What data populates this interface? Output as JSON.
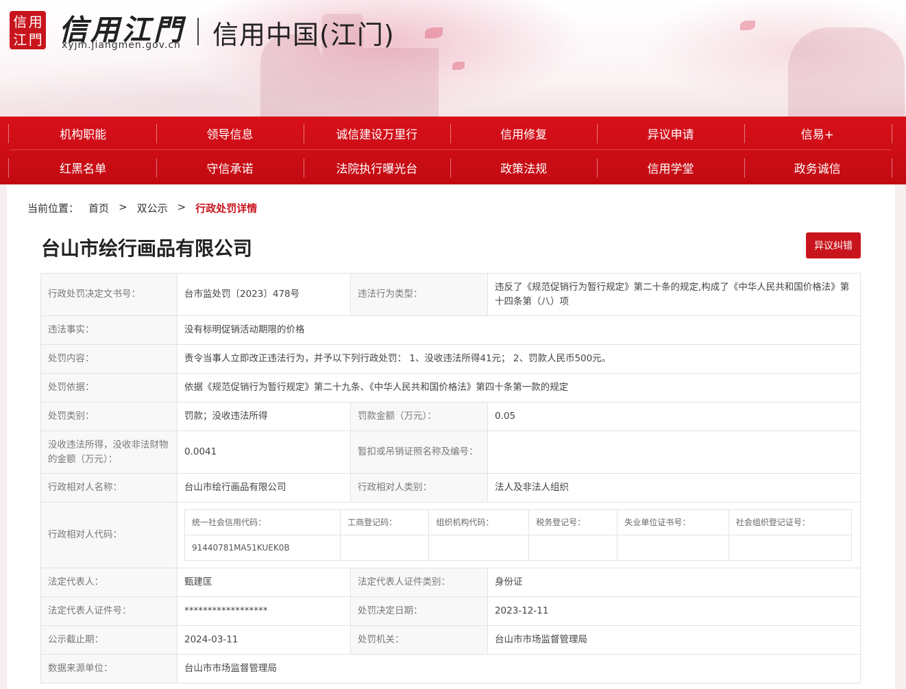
{
  "header": {
    "logo_seal": [
      "信",
      "用",
      "江",
      "門"
    ],
    "brand_title": "信用江門",
    "brand_domain": "xyjm.jiangmen.gov.cn",
    "sub_title": "信用中国(江门)"
  },
  "nav": {
    "row1": [
      "机构职能",
      "领导信息",
      "诚信建设万里行",
      "信用修复",
      "异议申请",
      "信易+"
    ],
    "row2": [
      "红黑名单",
      "守信承诺",
      "法院执行曝光台",
      "政策法规",
      "信用学堂",
      "政务诚信"
    ]
  },
  "breadcrumb": {
    "prefix": "当前位置：",
    "home": "首页",
    "sep": ">",
    "level2": "双公示",
    "current": "行政处罚详情"
  },
  "page": {
    "company_name": "台山市绘行画品有限公司",
    "objection_button": "异议纠错"
  },
  "details": {
    "decision_no_label": "行政处罚决定文书号：",
    "decision_no": "台市监处罚〔2023〕478号",
    "violation_type_label": "违法行为类型：",
    "violation_type": "违反了《规范促销行为暂行规定》第二十条的规定,构成了《中华人民共和国价格法》第十四条第（八）项",
    "facts_label": "违法事实：",
    "facts": "没有标明促销活动期限的价格",
    "content_label": "处罚内容：",
    "content": "责令当事人立即改正违法行为，并予以下列行政处罚： 1、没收违法所得41元； 2、罚款人民币500元。",
    "basis_label": "处罚依据：",
    "basis": "依据《规范促销行为暂行规定》第二十九条、《中华人民共和国价格法》第四十条第一款的规定",
    "category_label": "处罚类别：",
    "category": "罚款；没收违法所得",
    "fine_label": "罚款金额（万元）：",
    "fine": "0.05",
    "confiscated_label": "没收违法所得，没收非法财物的金额（万元）：",
    "confiscated": "0.0041",
    "license_label": "暂扣或吊销证照名称及编号：",
    "license": "",
    "party_name_label": "行政相对人名称：",
    "party_name": "台山市绘行画品有限公司",
    "party_type_label": "行政相对人类别：",
    "party_type": "法人及非法人组织",
    "party_code_label": "行政相对人代码：",
    "codes_head": [
      "统一社会信用代码：",
      "工商登记码：",
      "组织机构代码：",
      "税务登记号：",
      "失业单位证书号：",
      "社会组织登记证号："
    ],
    "codes_values": [
      "91440781MA51KUEK0B",
      "",
      "",
      "",
      "",
      ""
    ],
    "legal_rep_label": "法定代表人：",
    "legal_rep": "甄建匡",
    "legal_rep_id_type_label": "法定代表人证件类别：",
    "legal_rep_id_type": "身份证",
    "legal_rep_id_no_label": "法定代表人证件号：",
    "legal_rep_id_no": "******************",
    "decision_date_label": "处罚决定日期：",
    "decision_date": "2023-12-11",
    "publicity_end_label": "公示截止期：",
    "publicity_end": "2024-03-11",
    "authority_label": "处罚机关：",
    "authority": "台山市市场监督管理局",
    "data_source_label": "数据来源单位：",
    "data_source": "台山市市场监督管理局"
  }
}
